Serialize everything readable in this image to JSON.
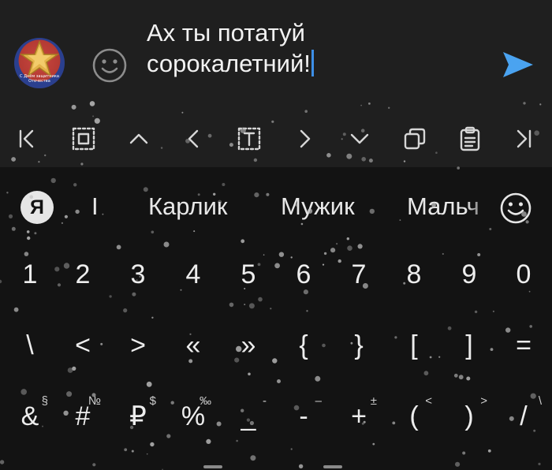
{
  "compose": {
    "avatar_caption": "С Днём защитника Отечества",
    "message": "Ах ты потатуй\nсорокалетний!"
  },
  "edit_toolbar": {
    "buttons": [
      "jump-to-start",
      "select",
      "up",
      "left",
      "select-word",
      "right",
      "down",
      "copy",
      "clipboard",
      "jump-to-end"
    ]
  },
  "keyboard": {
    "yandex_label": "Я",
    "suggestions": [
      "I",
      "Карлик",
      "Мужик",
      "Мальч"
    ],
    "rows": [
      [
        {
          "k": "1"
        },
        {
          "k": "2"
        },
        {
          "k": "3"
        },
        {
          "k": "4"
        },
        {
          "k": "5"
        },
        {
          "k": "6"
        },
        {
          "k": "7"
        },
        {
          "k": "8"
        },
        {
          "k": "9"
        },
        {
          "k": "0"
        }
      ],
      [
        {
          "k": "\\"
        },
        {
          "k": "<"
        },
        {
          "k": ">"
        },
        {
          "k": "«"
        },
        {
          "k": "»"
        },
        {
          "k": "{"
        },
        {
          "k": "}"
        },
        {
          "k": "["
        },
        {
          "k": "]"
        },
        {
          "k": "="
        }
      ],
      [
        {
          "k": "&",
          "h": "§"
        },
        {
          "k": "#",
          "h": "№"
        },
        {
          "k": "₽",
          "h": "$"
        },
        {
          "k": "%",
          "h": "‰"
        },
        {
          "k": "_",
          "h": "-"
        },
        {
          "k": "-",
          "h": "–"
        },
        {
          "k": "+",
          "h": "±"
        },
        {
          "k": "(",
          "h": "<"
        },
        {
          "k": ")",
          "h": ">"
        },
        {
          "k": "/",
          "h": "\\"
        }
      ]
    ]
  },
  "colors": {
    "accent": "#3d8fe8",
    "send": "#4aa3f0",
    "background": "#131313",
    "panel": "#1f1f1f"
  }
}
